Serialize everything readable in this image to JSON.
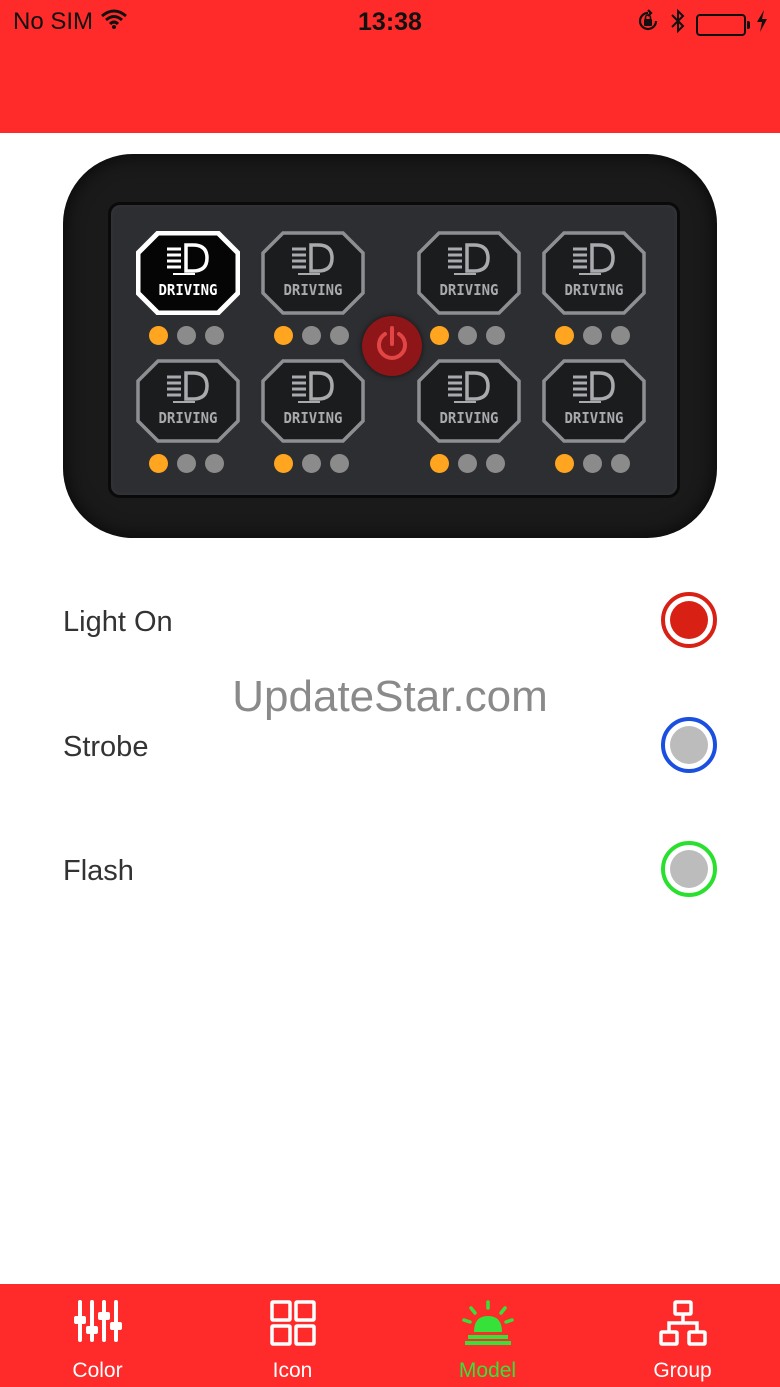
{
  "status_bar": {
    "carrier": "No SIM",
    "time": "13:38"
  },
  "panel": {
    "switches": [
      {
        "label": "DRIVING",
        "active": true,
        "level_on": 1
      },
      {
        "label": "DRIVING",
        "active": false,
        "level_on": 1
      },
      {
        "label": "DRIVING",
        "active": false,
        "level_on": 1
      },
      {
        "label": "DRIVING",
        "active": false,
        "level_on": 1
      },
      {
        "label": "DRIVING",
        "active": false,
        "level_on": 1
      },
      {
        "label": "DRIVING",
        "active": false,
        "level_on": 1
      },
      {
        "label": "DRIVING",
        "active": false,
        "level_on": 1
      },
      {
        "label": "DRIVING",
        "active": false,
        "level_on": 1
      }
    ],
    "power_icon": "power-icon"
  },
  "modes": [
    {
      "label": "Light On",
      "ring_color": "#d92015",
      "fill_color": "#d92015",
      "selected": true
    },
    {
      "label": "Strobe",
      "ring_color": "#1a4fe0",
      "fill_color": "#bcbcbc",
      "selected": false
    },
    {
      "label": "Flash",
      "ring_color": "#29e02e",
      "fill_color": "#bcbcbc",
      "selected": false
    }
  ],
  "watermark": "UpdateStar.com",
  "tabs": [
    {
      "label": "Color",
      "icon": "sliders-icon",
      "active": false
    },
    {
      "label": "Icon",
      "icon": "grid-icon",
      "active": false
    },
    {
      "label": "Model",
      "icon": "beacon-icon",
      "active": true
    },
    {
      "label": "Group",
      "icon": "hierarchy-icon",
      "active": false
    }
  ],
  "colors": {
    "brand": "#ff2a2a",
    "active_tab": "#36e23a",
    "led_on": "#ffa51f",
    "led_off": "#8b8b8b"
  }
}
